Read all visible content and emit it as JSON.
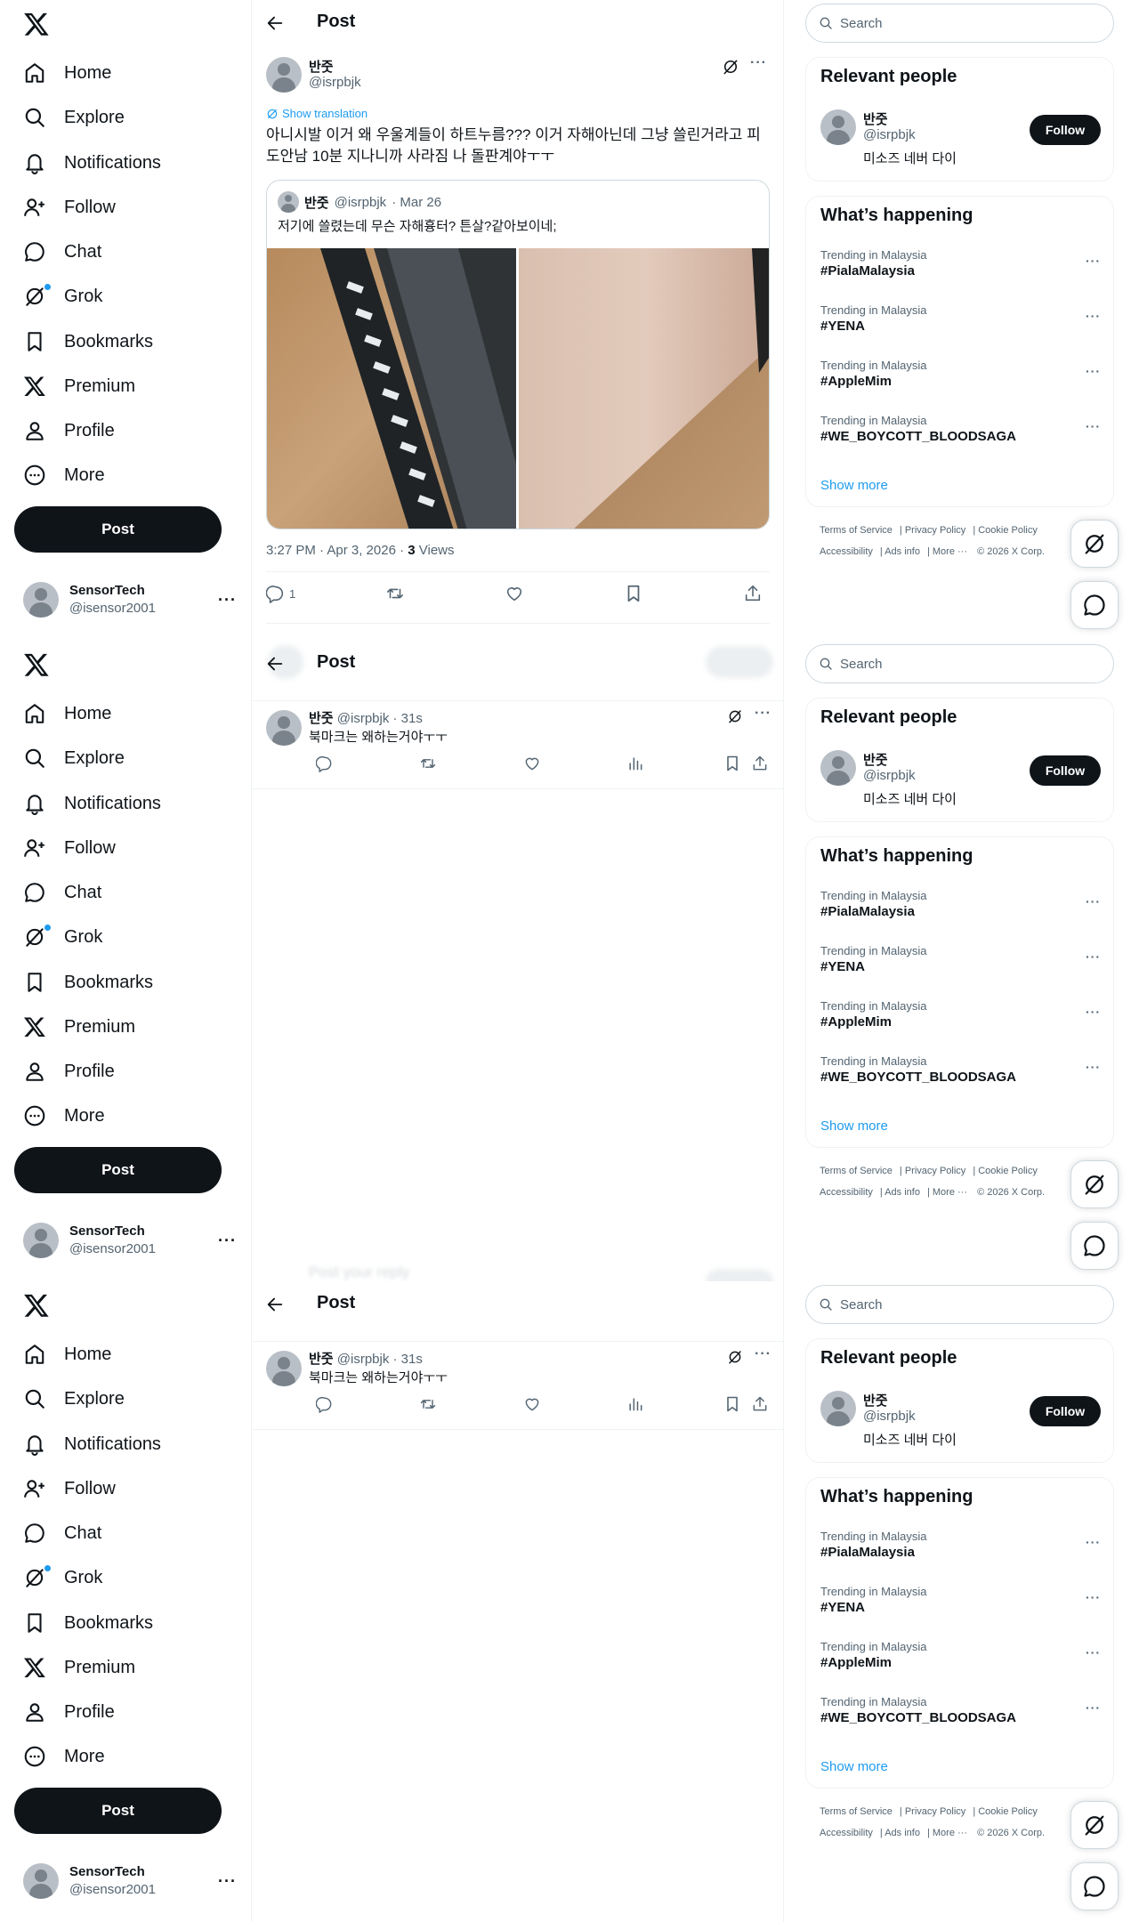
{
  "nav": {
    "items": [
      {
        "label": "Home",
        "icon": "home-icon"
      },
      {
        "label": "Explore",
        "icon": "search-icon"
      },
      {
        "label": "Notifications",
        "icon": "bell-icon"
      },
      {
        "label": "Follow",
        "icon": "person-plus-icon"
      },
      {
        "label": "Chat",
        "icon": "chat-icon"
      },
      {
        "label": "Grok",
        "icon": "grok-icon"
      },
      {
        "label": "Bookmarks",
        "icon": "bookmark-icon"
      },
      {
        "label": "Premium",
        "icon": "x-logo-icon"
      },
      {
        "label": "Profile",
        "icon": "person-icon"
      },
      {
        "label": "More",
        "icon": "more-circle-icon"
      }
    ],
    "post_label": "Post"
  },
  "account": {
    "name": "SensorTech",
    "handle": "@isensor2001",
    "more": "···"
  },
  "header": {
    "title": "Post"
  },
  "tweet": {
    "name": "반줏",
    "handle": "@isrpbjk",
    "show_translation": "Show translation",
    "text": "아니시발 이거 왜 우울계들이 하트누름??? 이거 자해아닌데 그냥 쓸린거라고 피도안남 10분 지나니까 사라짐 나 돌판계야ㅜㅜ",
    "quote": {
      "name": "반줏",
      "handle": "@isrpbjk",
      "date": "· Mar 26",
      "text": "저기에 쓸렸는데 무슨 자해흉터? 튼살?같아보이네;"
    },
    "time": "3:27 PM · Apr 3, 2026 · ",
    "views_count": "3",
    "views_label": " Views",
    "reply_count": "1"
  },
  "reply": {
    "name": "반줏",
    "handle_time": "@isrpbjk · 31s",
    "text": "북마크는 왜하는거야ㅜㅜ",
    "ghost_text": "Post your reply"
  },
  "right": {
    "search_placeholder": "Search",
    "relevant_title": "Relevant people",
    "person": {
      "name": "반줏",
      "handle": "@isrpbjk",
      "bio": "미소즈 네버 다이",
      "follow_label": "Follow"
    },
    "happening_title": "What’s happening",
    "trends": [
      {
        "category": "Trending in Malaysia",
        "tag": "#PialaMalaysia"
      },
      {
        "category": "Trending in Malaysia",
        "tag": "#YENA"
      },
      {
        "category": "Trending in Malaysia",
        "tag": "#AppleMim"
      },
      {
        "category": "Trending in Malaysia",
        "tag": "#WE_BOYCOTT_BLOODSAGA"
      }
    ],
    "show_more": "Show more",
    "footer": {
      "terms": "Terms of Service",
      "privacy": "Privacy Policy",
      "cookie": "Cookie Policy",
      "accessibility": "Accessibility",
      "ads": "Ads info",
      "more": "More ···",
      "copyright": "© 2026 X Corp."
    }
  },
  "colors": {
    "accent": "#1d9bf0",
    "text": "#0f1419",
    "muted": "#536471",
    "border": "#eff3f4"
  }
}
